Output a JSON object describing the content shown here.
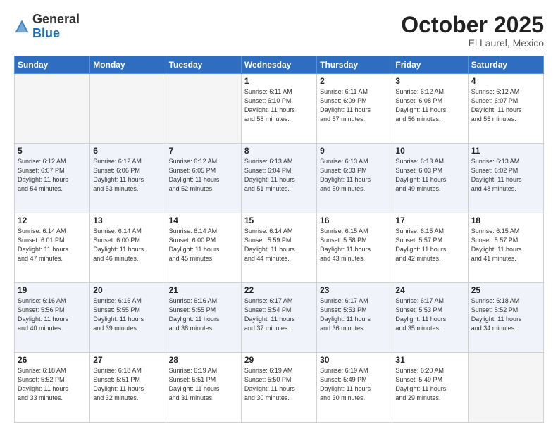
{
  "header": {
    "logo_general": "General",
    "logo_blue": "Blue",
    "month": "October 2025",
    "location": "El Laurel, Mexico"
  },
  "weekdays": [
    "Sunday",
    "Monday",
    "Tuesday",
    "Wednesday",
    "Thursday",
    "Friday",
    "Saturday"
  ],
  "weeks": [
    [
      {
        "day": "",
        "info": ""
      },
      {
        "day": "",
        "info": ""
      },
      {
        "day": "",
        "info": ""
      },
      {
        "day": "1",
        "info": "Sunrise: 6:11 AM\nSunset: 6:10 PM\nDaylight: 11 hours\nand 58 minutes."
      },
      {
        "day": "2",
        "info": "Sunrise: 6:11 AM\nSunset: 6:09 PM\nDaylight: 11 hours\nand 57 minutes."
      },
      {
        "day": "3",
        "info": "Sunrise: 6:12 AM\nSunset: 6:08 PM\nDaylight: 11 hours\nand 56 minutes."
      },
      {
        "day": "4",
        "info": "Sunrise: 6:12 AM\nSunset: 6:07 PM\nDaylight: 11 hours\nand 55 minutes."
      }
    ],
    [
      {
        "day": "5",
        "info": "Sunrise: 6:12 AM\nSunset: 6:07 PM\nDaylight: 11 hours\nand 54 minutes."
      },
      {
        "day": "6",
        "info": "Sunrise: 6:12 AM\nSunset: 6:06 PM\nDaylight: 11 hours\nand 53 minutes."
      },
      {
        "day": "7",
        "info": "Sunrise: 6:12 AM\nSunset: 6:05 PM\nDaylight: 11 hours\nand 52 minutes."
      },
      {
        "day": "8",
        "info": "Sunrise: 6:13 AM\nSunset: 6:04 PM\nDaylight: 11 hours\nand 51 minutes."
      },
      {
        "day": "9",
        "info": "Sunrise: 6:13 AM\nSunset: 6:03 PM\nDaylight: 11 hours\nand 50 minutes."
      },
      {
        "day": "10",
        "info": "Sunrise: 6:13 AM\nSunset: 6:03 PM\nDaylight: 11 hours\nand 49 minutes."
      },
      {
        "day": "11",
        "info": "Sunrise: 6:13 AM\nSunset: 6:02 PM\nDaylight: 11 hours\nand 48 minutes."
      }
    ],
    [
      {
        "day": "12",
        "info": "Sunrise: 6:14 AM\nSunset: 6:01 PM\nDaylight: 11 hours\nand 47 minutes."
      },
      {
        "day": "13",
        "info": "Sunrise: 6:14 AM\nSunset: 6:00 PM\nDaylight: 11 hours\nand 46 minutes."
      },
      {
        "day": "14",
        "info": "Sunrise: 6:14 AM\nSunset: 6:00 PM\nDaylight: 11 hours\nand 45 minutes."
      },
      {
        "day": "15",
        "info": "Sunrise: 6:14 AM\nSunset: 5:59 PM\nDaylight: 11 hours\nand 44 minutes."
      },
      {
        "day": "16",
        "info": "Sunrise: 6:15 AM\nSunset: 5:58 PM\nDaylight: 11 hours\nand 43 minutes."
      },
      {
        "day": "17",
        "info": "Sunrise: 6:15 AM\nSunset: 5:57 PM\nDaylight: 11 hours\nand 42 minutes."
      },
      {
        "day": "18",
        "info": "Sunrise: 6:15 AM\nSunset: 5:57 PM\nDaylight: 11 hours\nand 41 minutes."
      }
    ],
    [
      {
        "day": "19",
        "info": "Sunrise: 6:16 AM\nSunset: 5:56 PM\nDaylight: 11 hours\nand 40 minutes."
      },
      {
        "day": "20",
        "info": "Sunrise: 6:16 AM\nSunset: 5:55 PM\nDaylight: 11 hours\nand 39 minutes."
      },
      {
        "day": "21",
        "info": "Sunrise: 6:16 AM\nSunset: 5:55 PM\nDaylight: 11 hours\nand 38 minutes."
      },
      {
        "day": "22",
        "info": "Sunrise: 6:17 AM\nSunset: 5:54 PM\nDaylight: 11 hours\nand 37 minutes."
      },
      {
        "day": "23",
        "info": "Sunrise: 6:17 AM\nSunset: 5:53 PM\nDaylight: 11 hours\nand 36 minutes."
      },
      {
        "day": "24",
        "info": "Sunrise: 6:17 AM\nSunset: 5:53 PM\nDaylight: 11 hours\nand 35 minutes."
      },
      {
        "day": "25",
        "info": "Sunrise: 6:18 AM\nSunset: 5:52 PM\nDaylight: 11 hours\nand 34 minutes."
      }
    ],
    [
      {
        "day": "26",
        "info": "Sunrise: 6:18 AM\nSunset: 5:52 PM\nDaylight: 11 hours\nand 33 minutes."
      },
      {
        "day": "27",
        "info": "Sunrise: 6:18 AM\nSunset: 5:51 PM\nDaylight: 11 hours\nand 32 minutes."
      },
      {
        "day": "28",
        "info": "Sunrise: 6:19 AM\nSunset: 5:51 PM\nDaylight: 11 hours\nand 31 minutes."
      },
      {
        "day": "29",
        "info": "Sunrise: 6:19 AM\nSunset: 5:50 PM\nDaylight: 11 hours\nand 30 minutes."
      },
      {
        "day": "30",
        "info": "Sunrise: 6:19 AM\nSunset: 5:49 PM\nDaylight: 11 hours\nand 30 minutes."
      },
      {
        "day": "31",
        "info": "Sunrise: 6:20 AM\nSunset: 5:49 PM\nDaylight: 11 hours\nand 29 minutes."
      },
      {
        "day": "",
        "info": ""
      }
    ]
  ]
}
